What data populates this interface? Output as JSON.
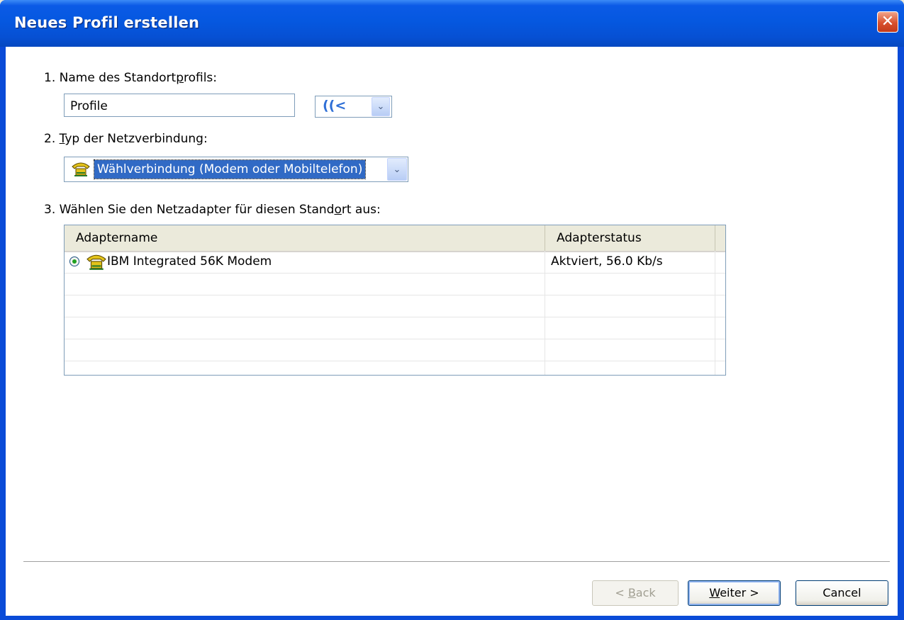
{
  "window": {
    "title": "Neues Profil erstellen",
    "close_glyph": "✕"
  },
  "step1": {
    "label_pre": "1. Name des Standort",
    "label_u": "p",
    "label_post": "rofils:",
    "input_value": "Profile",
    "icon_glyph": "((<",
    "arrow": "⌄"
  },
  "step2": {
    "label_pre": "2. ",
    "label_u": "T",
    "label_post": "yp der Netzverbindung:",
    "selected": "Wählverbindung (Modem oder Mobiltelefon)",
    "arrow": "⌄"
  },
  "step3": {
    "label_pre": "3. Wählen Sie den Netzadapter für diesen Stand",
    "label_u": "o",
    "label_post": "rt aus:"
  },
  "table": {
    "columns": [
      "Adaptername",
      "Adapterstatus"
    ],
    "rows": [
      {
        "name": "IBM Integrated 56K Modem",
        "status": "Aktviert, 56.0 Kb/s",
        "selected": true
      }
    ]
  },
  "buttons": {
    "back_pre": "< ",
    "back_u": "B",
    "back_post": "ack",
    "next_u": "W",
    "next_post": "eiter >",
    "cancel": "Cancel"
  },
  "colors": {
    "title_blue": "#0558e0",
    "selection_blue": "#316ac5",
    "close_red": "#d9502d"
  },
  "icons": [
    "close-icon",
    "network-profile-icon",
    "dropdown-arrow-icon",
    "modem-phone-icon",
    "radio-selected-icon"
  ]
}
